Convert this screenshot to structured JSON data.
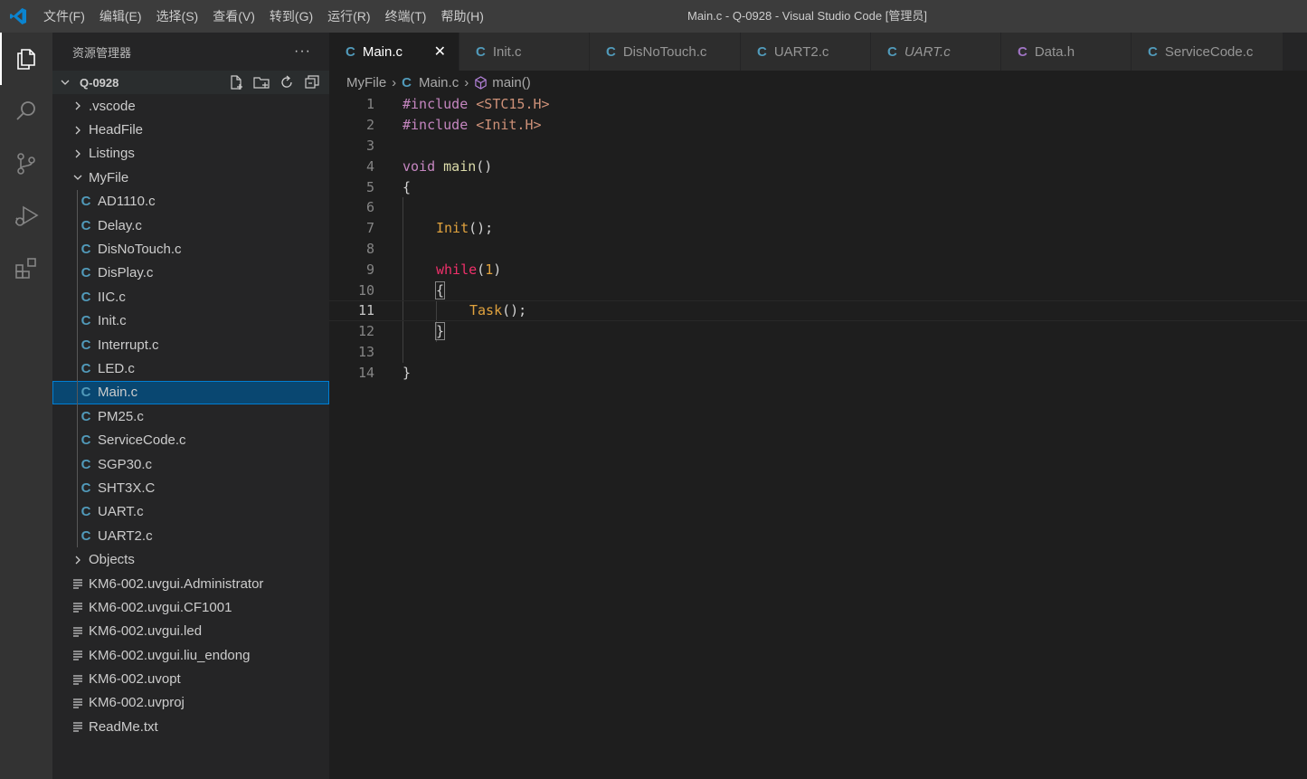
{
  "titlebar": {
    "menu": [
      "文件(F)",
      "编辑(E)",
      "选择(S)",
      "查看(V)",
      "转到(G)",
      "运行(R)",
      "终端(T)",
      "帮助(H)"
    ],
    "window_title": "Main.c - Q-0928 - Visual Studio Code [管理员]"
  },
  "activitybar": {
    "icons": [
      "explorer-icon",
      "search-icon",
      "source-control-icon",
      "run-debug-icon",
      "extensions-icon"
    ]
  },
  "sidebar": {
    "title": "资源管理器",
    "more": "···",
    "root": "Q-0928",
    "items": [
      {
        "label": ".vscode",
        "kind": "folder"
      },
      {
        "label": "HeadFile",
        "kind": "folder"
      },
      {
        "label": "Listings",
        "kind": "folder"
      },
      {
        "label": "MyFile",
        "kind": "folder-open"
      },
      {
        "label": "AD1110.c",
        "kind": "c"
      },
      {
        "label": "Delay.c",
        "kind": "c"
      },
      {
        "label": "DisNoTouch.c",
        "kind": "c"
      },
      {
        "label": "DisPlay.c",
        "kind": "c"
      },
      {
        "label": "IIC.c",
        "kind": "c"
      },
      {
        "label": "Init.c",
        "kind": "c"
      },
      {
        "label": "Interrupt.c",
        "kind": "c"
      },
      {
        "label": "LED.c",
        "kind": "c"
      },
      {
        "label": "Main.c",
        "kind": "c"
      },
      {
        "label": "PM25.c",
        "kind": "c"
      },
      {
        "label": "ServiceCode.c",
        "kind": "c"
      },
      {
        "label": "SGP30.c",
        "kind": "c"
      },
      {
        "label": "SHT3X.C",
        "kind": "cpp"
      },
      {
        "label": "UART.c",
        "kind": "c"
      },
      {
        "label": "UART2.c",
        "kind": "c"
      },
      {
        "label": "Objects",
        "kind": "folder"
      },
      {
        "label": "KM6-002.uvgui.Administrator",
        "kind": "text"
      },
      {
        "label": "KM6-002.uvgui.CF1001",
        "kind": "text"
      },
      {
        "label": "KM6-002.uvgui.led",
        "kind": "text"
      },
      {
        "label": "KM6-002.uvgui.liu_endong",
        "kind": "text"
      },
      {
        "label": "KM6-002.uvopt",
        "kind": "text"
      },
      {
        "label": "KM6-002.uvproj",
        "kind": "text"
      },
      {
        "label": "ReadMe.txt",
        "kind": "text"
      }
    ]
  },
  "tabs": [
    {
      "label": "Main.c",
      "icon": "C",
      "active": true
    },
    {
      "label": "Init.c",
      "icon": "C",
      "active": false
    },
    {
      "label": "DisNoTouch.c",
      "icon": "C",
      "active": false
    },
    {
      "label": "UART2.c",
      "icon": "C",
      "active": false
    },
    {
      "label": "UART.c",
      "icon": "C",
      "active": false,
      "italic": true
    },
    {
      "label": "Data.h",
      "icon": "C",
      "active": false
    },
    {
      "label": "ServiceCode.c",
      "icon": "C",
      "active": false
    }
  ],
  "breadcrumb": {
    "folder": "MyFile",
    "file": "Main.c",
    "symbol": "main()"
  },
  "editor": {
    "line_numbers": [
      "1",
      "2",
      "3",
      "4",
      "5",
      "6",
      "7",
      "8",
      "9",
      "10",
      "11",
      "12",
      "13",
      "14"
    ],
    "current_line": "11",
    "code": {
      "l1_kw": "#include",
      "l1_str": "<STC15.H>",
      "l2_kw": "#include",
      "l2_str": "<Init.H>",
      "l4_type": "void",
      "l4_fn": "main",
      "l4_rest": "()",
      "l5": "{",
      "l7_fn": "Init",
      "l7_rest": "();",
      "l9_kw": "while",
      "l9_open": "(",
      "l9_num": "1",
      "l9_close": ")",
      "l10": "{",
      "l11_fn": "Task",
      "l11_rest": "();",
      "l12": "}",
      "l14": "}"
    }
  },
  "colors": {
    "accent": "#007acc",
    "selection": "#094771",
    "c_icon": "#519aba",
    "h_icon": "#a074c4"
  }
}
